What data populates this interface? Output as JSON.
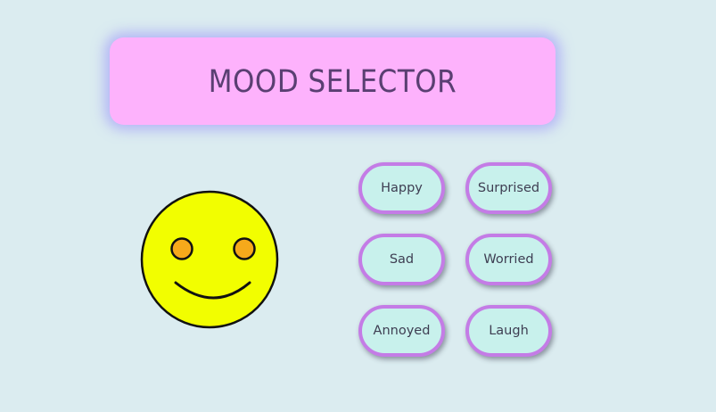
{
  "title": "MOOD SELECTOR",
  "colors": {
    "background": "#dbecf0",
    "banner": "#fdb2fc",
    "banner_glow": "#968cfa",
    "title_text": "#5a3f72",
    "face": "#f2fe00",
    "eyes": "#f6a91b",
    "button_fill": "#c8f1ec",
    "button_border": "#c47ce6"
  },
  "face": {
    "expression": "happy",
    "icon": "smiley-face-icon"
  },
  "moods": [
    {
      "label": "Happy"
    },
    {
      "label": "Surprised"
    },
    {
      "label": "Sad"
    },
    {
      "label": "Worried"
    },
    {
      "label": "Annoyed"
    },
    {
      "label": "Laugh"
    }
  ]
}
